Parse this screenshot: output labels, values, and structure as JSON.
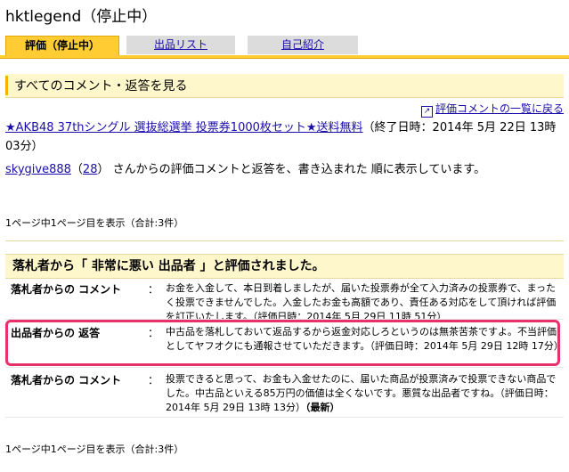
{
  "page": {
    "title": "hktlegend（停止中）"
  },
  "tabs": [
    {
      "label": "評価（停止中）"
    },
    {
      "label": "出品リスト"
    },
    {
      "label": "自己紹介"
    }
  ],
  "section": {
    "heading": "すべてのコメント・返答を見る"
  },
  "back_link": {
    "label": "評価コメントの一覧に戻る"
  },
  "auction": {
    "title": "★AKB48 37thシングル 選抜総選挙 投票券1000枚セット★送料無料",
    "end_time": "（終了日時：2014年 5月 22日 13時 03分）"
  },
  "user": {
    "name": "skygive888",
    "rating": "28",
    "description": "さんからの評価コメントと返答を、書き込まれた 順に表示しています。"
  },
  "pagination": {
    "text": "1ページ中1ページ目を表示（合計:3件）"
  },
  "evaluation": {
    "heading": "落札者から「 非常に悪い 出品者 」と評価されました。"
  },
  "comments": [
    {
      "label": "落札者からの コメント",
      "colon": "：",
      "body": "お金を入金して、本日到着しましたが、届いた投票券が全て入力済みの投票券で、まったく投票できませんでした。入金したお金も高額であり、責任ある対応をして頂ければ評価を訂正いたします。（評価日時：2014年 5月 29日 11時 51分）"
    },
    {
      "label": "出品者からの 返答",
      "colon": "：",
      "body": "中古品を落札しておいて返品するから返金対応しろというのは無茶苦茶ですよ。不当評価としてヤフオクにも通報させていただきます。（評価日時：2014年 5月 29日 12時 17分）"
    },
    {
      "label": "落札者からの コメント",
      "colon": "：",
      "body": "投票できると思って、お金も入金せたのに、届いた商品が投票済みで投票できない商品でした。中古品といえる85万円の価値は全くないです。悪質な出品者ですね。（評価日時：2014年 5月 29日 13時 13分）",
      "latest": "（最新）"
    }
  ],
  "colors": {
    "tab_active": "#ffcc33",
    "highlight_border": "#e8306b",
    "section_bg": "#fff7cc"
  }
}
